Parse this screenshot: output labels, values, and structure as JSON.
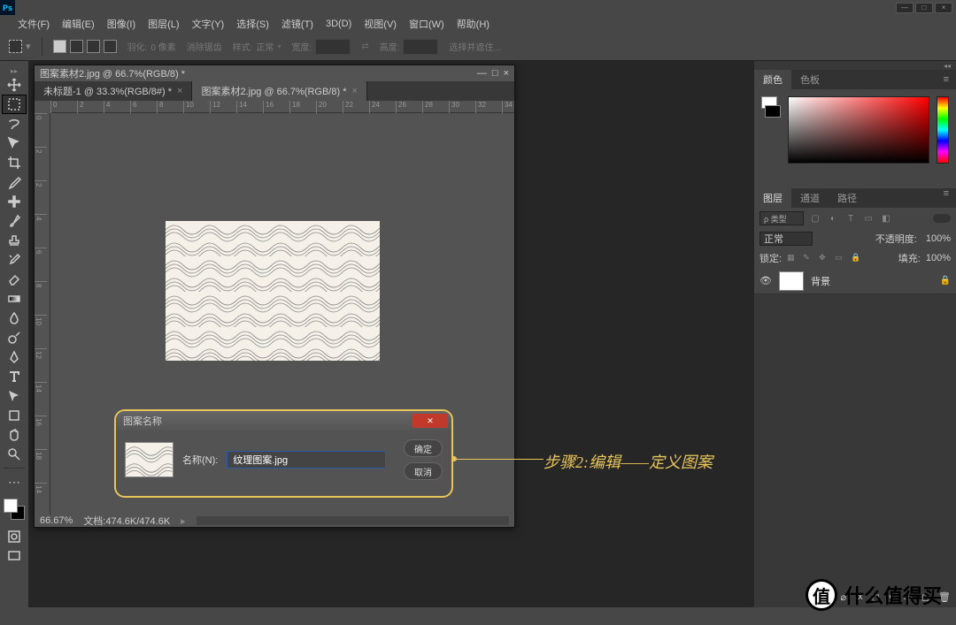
{
  "app": {
    "logo": "Ps"
  },
  "window_controls": {
    "min": "—",
    "max": "□",
    "close": "×"
  },
  "menubar": [
    "文件(F)",
    "编辑(E)",
    "图像(I)",
    "图层(L)",
    "文字(Y)",
    "选择(S)",
    "滤镜(T)",
    "3D(D)",
    "视图(V)",
    "窗口(W)",
    "帮助(H)"
  ],
  "options": {
    "feather_label": "羽化:",
    "feather_value": "0 像素",
    "antialias": "消除锯齿",
    "style_label": "样式:",
    "style_value": "正常",
    "width_label": "宽度:",
    "height_label": "高度:",
    "refine": "选择并遮住..."
  },
  "document": {
    "title": "图案素材2.jpg @ 66.7%(RGB/8) *",
    "tabs": [
      {
        "label": "未标题-1 @ 33.3%(RGB/8#) *",
        "active": false
      },
      {
        "label": "图案素材2.jpg @ 66.7%(RGB/8) *",
        "active": true
      }
    ],
    "ruler_h": [
      "0",
      "2",
      "4",
      "6",
      "8",
      "10",
      "12",
      "14",
      "16",
      "18",
      "20",
      "22",
      "24",
      "26",
      "28",
      "30",
      "32",
      "34"
    ],
    "ruler_v": [
      "0",
      "2",
      "2",
      "4",
      "6",
      "8",
      "10",
      "12",
      "14",
      "16",
      "18",
      "14"
    ],
    "status_zoom": "66.67%",
    "status_doc": "文档:474.6K/474.6K"
  },
  "dialog": {
    "title": "图案名称",
    "field_label": "名称(N):",
    "field_value": "纹理图案.jpg",
    "ok": "确定",
    "cancel": "取消",
    "close": "✕"
  },
  "annotation": "步骤2:编辑——定义图案",
  "panels": {
    "color_tabs": [
      "颜色",
      "色板"
    ],
    "layers_tabs": [
      "图层",
      "通道",
      "路径"
    ],
    "filter_label": "ρ 类型",
    "blend_mode": "正常",
    "opacity_label": "不透明度:",
    "opacity_value": "100%",
    "lock_label": "锁定:",
    "fill_label": "填充:",
    "fill_value": "100%",
    "layer_name": "背景"
  },
  "watermark": {
    "icon": "值",
    "text": "什么值得买"
  }
}
